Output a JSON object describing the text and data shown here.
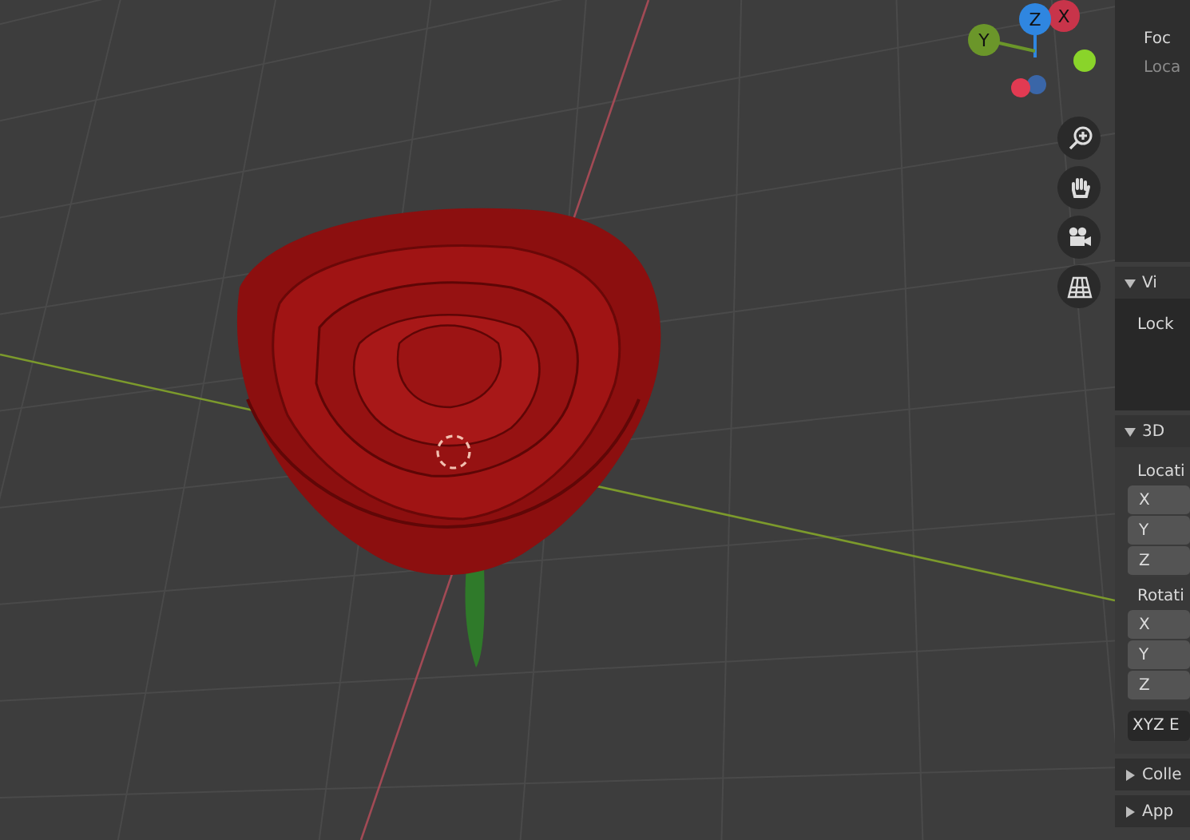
{
  "gizmo": {
    "axes": [
      {
        "label": "X",
        "color": "#c8344a"
      },
      {
        "label": "Z",
        "color": "#2f86e0"
      },
      {
        "label": "Y",
        "color": "#6b962a"
      }
    ]
  },
  "nav_buttons": [
    {
      "kind": "zoom"
    },
    {
      "kind": "pan"
    },
    {
      "kind": "camera"
    },
    {
      "kind": "grid"
    }
  ],
  "sidebar": {
    "panels": [
      {
        "items": [
          {
            "kind": "label",
            "text": "Foc",
            "muted": false
          },
          {
            "kind": "label",
            "text": "Loca",
            "muted": true
          }
        ]
      },
      {
        "header": "Vi",
        "expanded": true,
        "items": [
          {
            "kind": "label",
            "text": "Lock",
            "muted": false
          }
        ]
      },
      {
        "header": "3D",
        "expanded": true,
        "items": [
          {
            "kind": "label",
            "text": "Locati",
            "muted": false
          },
          {
            "kind": "field",
            "text": "X"
          },
          {
            "kind": "field",
            "text": "Y"
          },
          {
            "kind": "field",
            "text": "Z"
          },
          {
            "kind": "label",
            "text": "Rotati",
            "muted": false
          },
          {
            "kind": "field",
            "text": "X"
          },
          {
            "kind": "field",
            "text": "Y"
          },
          {
            "kind": "field",
            "text": "Z"
          },
          {
            "kind": "dropdown",
            "text": "XYZ E"
          }
        ]
      },
      {
        "header": "Colle",
        "expanded": false
      },
      {
        "header": "App",
        "expanded": false
      }
    ]
  }
}
